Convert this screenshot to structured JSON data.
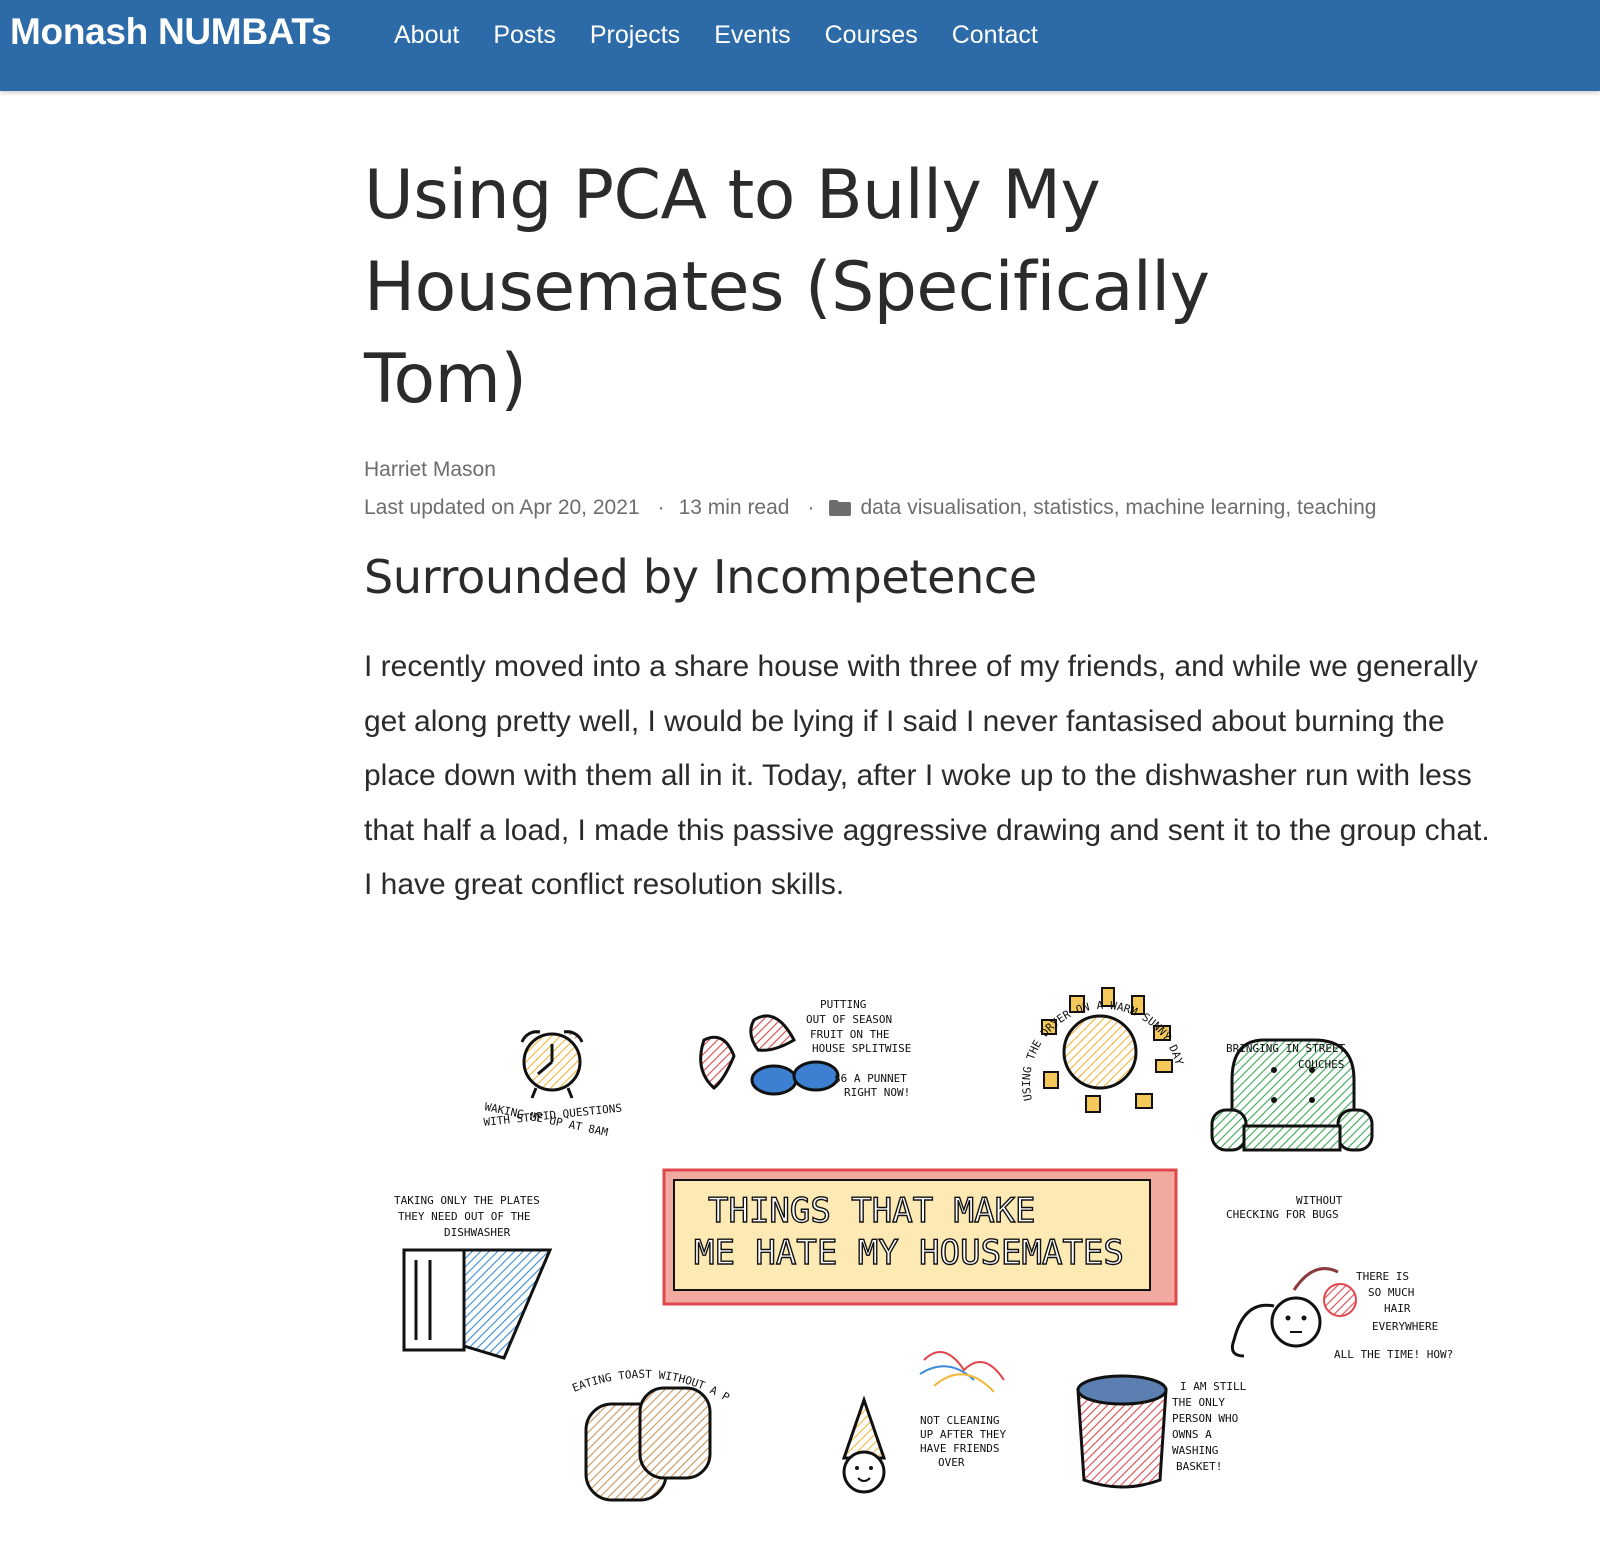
{
  "navbar": {
    "brand": "Monash NUMBATs",
    "items": [
      "About",
      "Posts",
      "Projects",
      "Events",
      "Courses",
      "Contact"
    ],
    "background": "#2d6aa8"
  },
  "article": {
    "title": "Using PCA to Bully My Housemates (Specifically Tom)",
    "author": "Harriet Mason",
    "last_updated": "Last updated on Apr 20, 2021",
    "read_time": "13 min read",
    "categories": "data visualisation, statistics, machine learning, teaching",
    "section_heading": "Surrounded by Incompetence",
    "paragraph": "I recently moved into a share house with three of my friends, and while we generally get along pretty well, I would be lying if I said I never fantasised about burning the place down with them all in it. Today, after I woke up to the dishwasher run with less that half a load, I made this passive aggressive drawing and sent it to the group chat. I have great conflict resolution skills."
  },
  "illustration": {
    "banner": [
      "THINGS THAT MAKE",
      "ME HATE MY HOUSEMATES"
    ],
    "captions": {
      "clock": [
        "WAKING ME UP AT 8AM",
        "WITH STUPID QUESTIONS"
      ],
      "fruit": [
        "PUTTING",
        "OUT OF SEASON",
        "FRUIT ON THE",
        "HOUSE SPLITWISE"
      ],
      "fruit_price": [
        "$6 A PUNNET",
        "RIGHT NOW!"
      ],
      "dryer": "USING THE DRYER ON A WARM SUNNY DAY",
      "couch": [
        "BRINGING IN STREET",
        "COUCHES",
        "WITHOUT",
        "CHECKING FOR BUGS"
      ],
      "dishwasher": [
        "TAKING ONLY THE PLATES",
        "THEY NEED OUT OF THE",
        "DISHWASHER"
      ],
      "hair": [
        "THERE IS",
        "SO MUCH",
        "HAIR",
        "EVERYWHERE",
        "ALL THE TIME! HOW?"
      ],
      "toast": "EATING TOAST WITHOUT A PLATE",
      "party": [
        "NOT CLEANING",
        "UP AFTER THEY",
        "HAVE FRIENDS",
        "OVER"
      ],
      "basket": [
        "I AM STILL",
        "THE ONLY",
        "PERSON WHO",
        "OWNS A",
        "WASHING",
        "BASKET!"
      ]
    }
  }
}
